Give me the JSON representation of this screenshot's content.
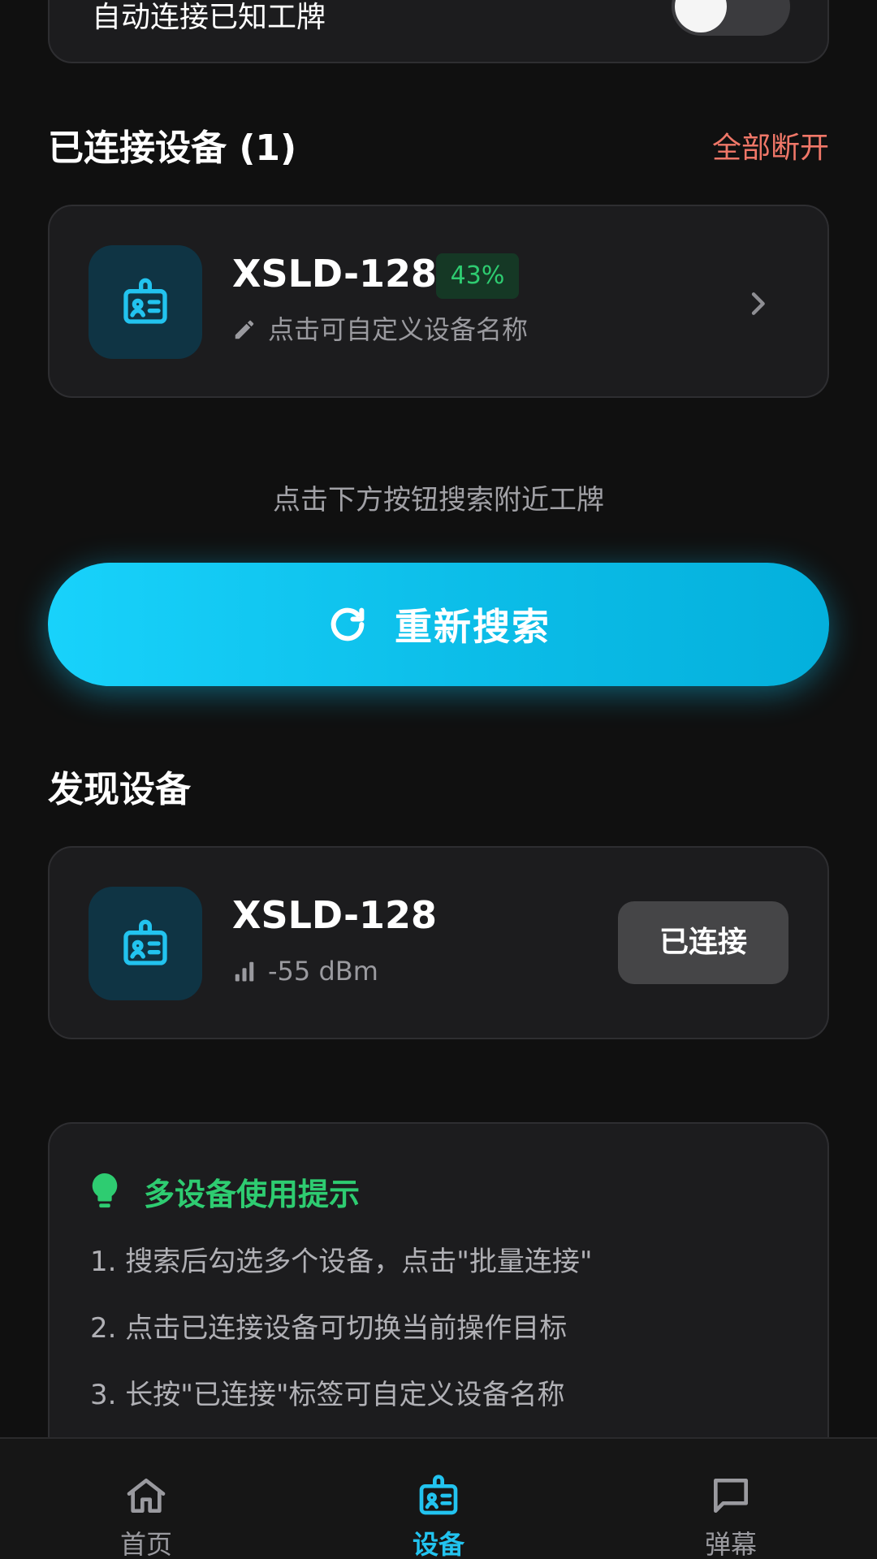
{
  "settings": {
    "auto_connect_label": "自动连接已知工牌",
    "auto_connect_on": false
  },
  "connected": {
    "title": "已连接设备 (1)",
    "disconnect_all": "全部断开",
    "devices": [
      {
        "name": "XSLD-128",
        "battery": "43%",
        "rename_hint": "点击可自定义设备名称",
        "icon": "badge-icon"
      }
    ]
  },
  "search": {
    "hint": "点击下方按钮搜索附近工牌",
    "button_label": "重新搜索",
    "icon": "refresh-icon"
  },
  "discovered": {
    "title": "发现设备",
    "devices": [
      {
        "name": "XSLD-128",
        "signal": "-55 dBm",
        "status_button": "已连接",
        "icon": "badge-icon"
      }
    ]
  },
  "tips": {
    "title": "多设备使用提示",
    "icon": "lightbulb-icon",
    "lines": [
      "1. 搜索后勾选多个设备，点击\"批量连接\"",
      "2. 点击已连接设备可切换当前操作目标",
      "3. 长按\"已连接\"标签可自定义设备名称"
    ]
  },
  "nav": {
    "items": [
      {
        "label": "首页",
        "icon": "home-icon",
        "active": false
      },
      {
        "label": "设备",
        "icon": "badge-icon",
        "active": true
      },
      {
        "label": "弹幕",
        "icon": "chat-icon",
        "active": false
      }
    ]
  },
  "colors": {
    "accent": "#18d2fb",
    "success": "#2ecc71",
    "danger": "#f07768",
    "background": "#101010",
    "card": "#1c1c1e"
  }
}
